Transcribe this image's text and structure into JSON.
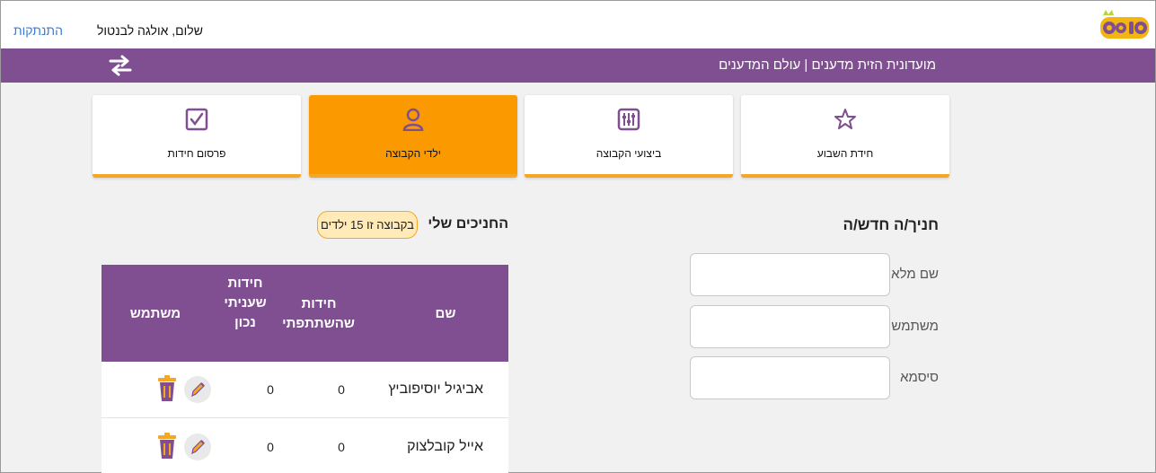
{
  "header": {
    "logout_label": "התנתקות",
    "greeting": "שלום, אולגה לבנטול",
    "logo_text": "אופיס"
  },
  "nav": {
    "breadcrumb": "מועדונית הזית מדענים | עולם המדענים"
  },
  "tiles": [
    {
      "label": "חידת השבוע",
      "icon": "star-icon"
    },
    {
      "label": "ביצועי הקבוצה",
      "icon": "sliders-icon"
    },
    {
      "label": "ילדי הקבוצה",
      "icon": "user-icon",
      "active": true
    },
    {
      "label": "פרסום חידות",
      "icon": "checkbox-icon"
    }
  ],
  "new_student": {
    "title": "חניך/ה חדש/ה",
    "fields": [
      {
        "label": "שם מלא",
        "value": ""
      },
      {
        "label": "משתמש",
        "value": ""
      },
      {
        "label": "סיסמא",
        "value": ""
      }
    ]
  },
  "students": {
    "title": "החניכים שלי",
    "count_badge": "בקבוצה זו 15 ילדים",
    "columns": {
      "name": "שם",
      "participated_l1": "חידות",
      "participated_l2": "שהשתתפתי",
      "correct_l1": "חידות",
      "correct_l2": "שעניתי",
      "correct_l3": "נכון",
      "user": "משתמש"
    },
    "rows": [
      {
        "name": "אביגיל יוסיפוביץ",
        "participated": "0",
        "correct": "0"
      },
      {
        "name": "אייל קובלצוק",
        "participated": "0",
        "correct": "0"
      }
    ]
  },
  "colors": {
    "purple": "#7f4f91",
    "orange": "#fa9a00",
    "accent_border": "#f5a623",
    "link": "#3a7bd5"
  }
}
